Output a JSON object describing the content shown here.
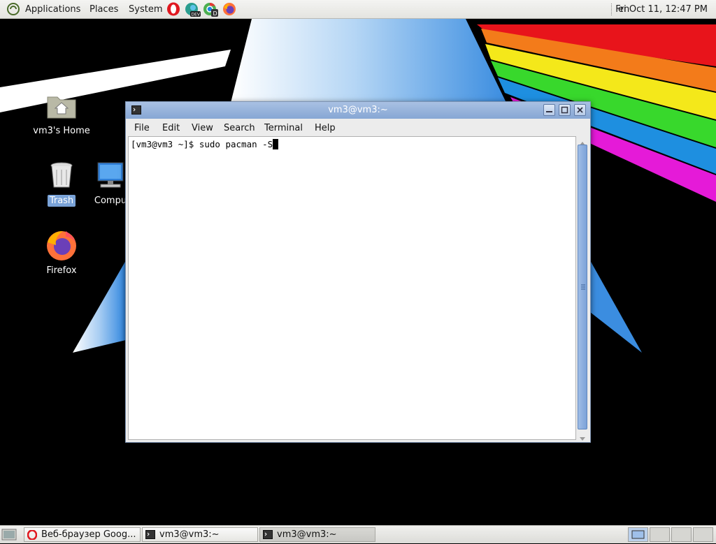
{
  "top_panel": {
    "menus": [
      "Applications",
      "Places",
      "System"
    ],
    "launchers": [
      "opera-icon",
      "edge-dev-icon",
      "chrome-dev-icon",
      "firefox-icon"
    ],
    "language": "en",
    "clock": "Fri Oct 11, 12:47 PM"
  },
  "desktop": {
    "icons": [
      {
        "label": "vm3's Home",
        "icon": "home-folder-icon"
      },
      {
        "label": "Trash",
        "icon": "trash-icon"
      },
      {
        "label": "Compu",
        "icon": "computer-icon"
      },
      {
        "label": "Firefox",
        "icon": "firefox-icon"
      }
    ]
  },
  "terminal": {
    "title": "vm3@vm3:~",
    "menu": [
      "File",
      "Edit",
      "View",
      "Search",
      "Terminal",
      "Help"
    ],
    "prompt": "[vm3@vm3 ~]$ sudo pacman -S"
  },
  "taskbar": {
    "tasks": [
      {
        "label": "Веб-браузер Goog...",
        "icon": "opera-icon"
      },
      {
        "label": "vm3@vm3:~",
        "icon": "terminal-icon"
      },
      {
        "label": "vm3@vm3:~",
        "icon": "terminal-icon"
      }
    ]
  },
  "colors": {
    "titlebar": "#86a6d4",
    "accent": "#7aa3d8",
    "panel": "#e4e4e0"
  }
}
